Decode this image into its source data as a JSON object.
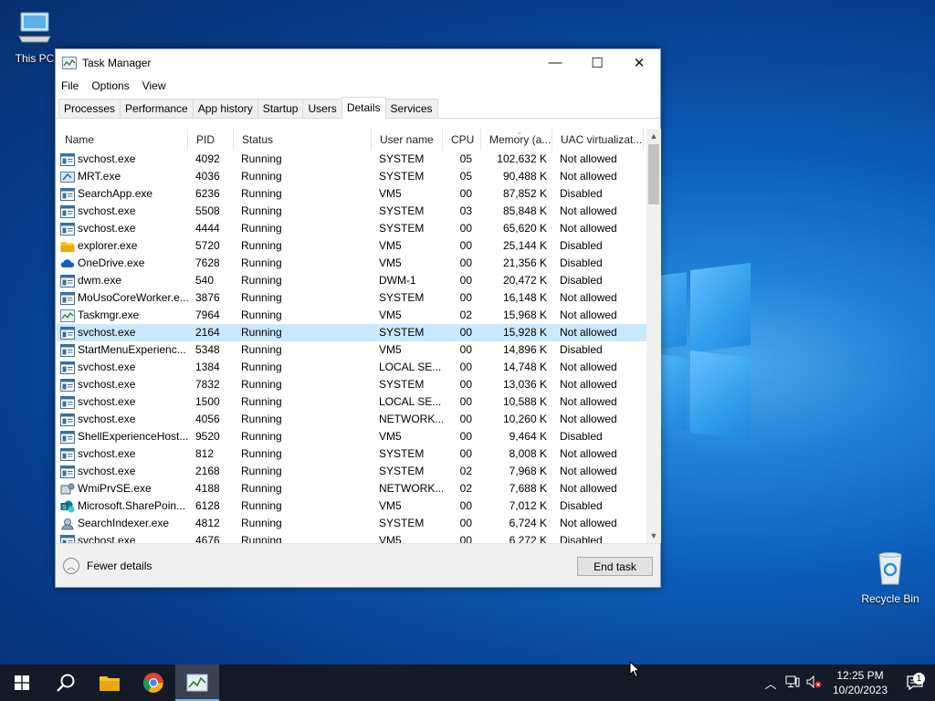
{
  "desktop": {
    "icons": [
      {
        "label": "This PC"
      },
      {
        "label": "Recycle Bin"
      }
    ]
  },
  "window": {
    "title": "Task Manager",
    "controls": {
      "minimize": "—",
      "maximize": "☐",
      "close": "✕"
    },
    "menu": [
      "File",
      "Options",
      "View"
    ],
    "tabs": [
      "Processes",
      "Performance",
      "App history",
      "Startup",
      "Users",
      "Details",
      "Services"
    ],
    "active_tab": "Details",
    "columns": [
      "Name",
      "PID",
      "Status",
      "User name",
      "CPU",
      "Memory (a...",
      "UAC virtualizat..."
    ],
    "rows": [
      {
        "name": "svchost.exe",
        "pid": "4092",
        "status": "Running",
        "user": "SYSTEM",
        "cpu": "05",
        "mem": "102,632 K",
        "uac": "Not allowed",
        "icon": "svc"
      },
      {
        "name": "MRT.exe",
        "pid": "4036",
        "status": "Running",
        "user": "SYSTEM",
        "cpu": "05",
        "mem": "90,488 K",
        "uac": "Not allowed",
        "icon": "mrt"
      },
      {
        "name": "SearchApp.exe",
        "pid": "6236",
        "status": "Running",
        "user": "VM5",
        "cpu": "00",
        "mem": "87,852 K",
        "uac": "Disabled",
        "icon": "svc"
      },
      {
        "name": "svchost.exe",
        "pid": "5508",
        "status": "Running",
        "user": "SYSTEM",
        "cpu": "03",
        "mem": "85,848 K",
        "uac": "Not allowed",
        "icon": "svc"
      },
      {
        "name": "svchost.exe",
        "pid": "4444",
        "status": "Running",
        "user": "SYSTEM",
        "cpu": "00",
        "mem": "65,620 K",
        "uac": "Not allowed",
        "icon": "svc"
      },
      {
        "name": "explorer.exe",
        "pid": "5720",
        "status": "Running",
        "user": "VM5",
        "cpu": "00",
        "mem": "25,144 K",
        "uac": "Disabled",
        "icon": "folder"
      },
      {
        "name": "OneDrive.exe",
        "pid": "7628",
        "status": "Running",
        "user": "VM5",
        "cpu": "00",
        "mem": "21,356 K",
        "uac": "Disabled",
        "icon": "cloud"
      },
      {
        "name": "dwm.exe",
        "pid": "540",
        "status": "Running",
        "user": "DWM-1",
        "cpu": "00",
        "mem": "20,472 K",
        "uac": "Disabled",
        "icon": "svc"
      },
      {
        "name": "MoUsoCoreWorker.e...",
        "pid": "3876",
        "status": "Running",
        "user": "SYSTEM",
        "cpu": "00",
        "mem": "16,148 K",
        "uac": "Not allowed",
        "icon": "svc"
      },
      {
        "name": "Taskmgr.exe",
        "pid": "7964",
        "status": "Running",
        "user": "VM5",
        "cpu": "02",
        "mem": "15,968 K",
        "uac": "Not allowed",
        "icon": "taskmgr"
      },
      {
        "name": "svchost.exe",
        "pid": "2164",
        "status": "Running",
        "user": "SYSTEM",
        "cpu": "00",
        "mem": "15,928 K",
        "uac": "Not allowed",
        "icon": "svc",
        "selected": true
      },
      {
        "name": "StartMenuExperienc...",
        "pid": "5348",
        "status": "Running",
        "user": "VM5",
        "cpu": "00",
        "mem": "14,896 K",
        "uac": "Disabled",
        "icon": "svc"
      },
      {
        "name": "svchost.exe",
        "pid": "1384",
        "status": "Running",
        "user": "LOCAL SE...",
        "cpu": "00",
        "mem": "14,748 K",
        "uac": "Not allowed",
        "icon": "svc"
      },
      {
        "name": "svchost.exe",
        "pid": "7832",
        "status": "Running",
        "user": "SYSTEM",
        "cpu": "00",
        "mem": "13,036 K",
        "uac": "Not allowed",
        "icon": "svc"
      },
      {
        "name": "svchost.exe",
        "pid": "1500",
        "status": "Running",
        "user": "LOCAL SE...",
        "cpu": "00",
        "mem": "10,588 K",
        "uac": "Not allowed",
        "icon": "svc"
      },
      {
        "name": "svchost.exe",
        "pid": "4056",
        "status": "Running",
        "user": "NETWORK...",
        "cpu": "00",
        "mem": "10,260 K",
        "uac": "Not allowed",
        "icon": "svc"
      },
      {
        "name": "ShellExperienceHost....",
        "pid": "9520",
        "status": "Running",
        "user": "VM5",
        "cpu": "00",
        "mem": "9,464 K",
        "uac": "Disabled",
        "icon": "svc"
      },
      {
        "name": "svchost.exe",
        "pid": "812",
        "status": "Running",
        "user": "SYSTEM",
        "cpu": "00",
        "mem": "8,008 K",
        "uac": "Not allowed",
        "icon": "svc"
      },
      {
        "name": "svchost.exe",
        "pid": "2168",
        "status": "Running",
        "user": "SYSTEM",
        "cpu": "02",
        "mem": "7,968 K",
        "uac": "Not allowed",
        "icon": "svc"
      },
      {
        "name": "WmiPrvSE.exe",
        "pid": "4188",
        "status": "Running",
        "user": "NETWORK...",
        "cpu": "02",
        "mem": "7,688 K",
        "uac": "Not allowed",
        "icon": "wmi"
      },
      {
        "name": "Microsoft.SharePoin...",
        "pid": "6128",
        "status": "Running",
        "user": "VM5",
        "cpu": "00",
        "mem": "7,012 K",
        "uac": "Disabled",
        "icon": "sharepoint"
      },
      {
        "name": "SearchIndexer.exe",
        "pid": "4812",
        "status": "Running",
        "user": "SYSTEM",
        "cpu": "00",
        "mem": "6,724 K",
        "uac": "Not allowed",
        "icon": "search"
      },
      {
        "name": "svchost.exe",
        "pid": "4676",
        "status": "Running",
        "user": "VM5",
        "cpu": "00",
        "mem": "6,272 K",
        "uac": "Disabled",
        "icon": "svc"
      }
    ],
    "footer": {
      "fewer_details": "Fewer details",
      "end_task": "End task"
    }
  },
  "taskbar": {
    "clock_time": "12:25 PM",
    "clock_date": "10/20/2023",
    "notification_count": "1"
  },
  "colors": {
    "selection": "#cce8ff",
    "taskbar": "#141a26",
    "accent": "#76b9ed"
  }
}
